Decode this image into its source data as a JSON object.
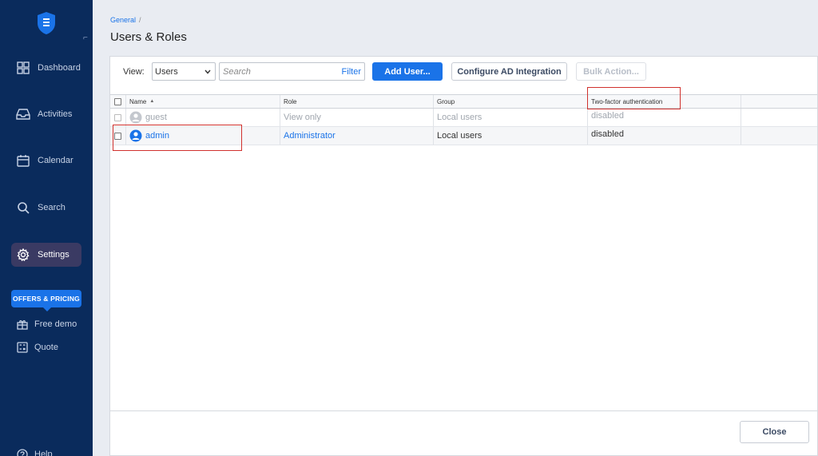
{
  "sidebar": {
    "items": [
      {
        "label": "Dashboard",
        "icon": "grid-icon"
      },
      {
        "label": "Activities",
        "icon": "inbox-icon"
      },
      {
        "label": "Calendar",
        "icon": "calendar-icon"
      },
      {
        "label": "Search",
        "icon": "search-icon"
      },
      {
        "label": "Settings",
        "icon": "gear-icon"
      }
    ],
    "offers_label": "OFFERS & PRICING",
    "free_demo_label": "Free demo",
    "quote_label": "Quote",
    "help_label": "Help"
  },
  "header": {
    "breadcrumb": "General",
    "breadcrumb_sep": "/",
    "title": "Users & Roles"
  },
  "toolbar": {
    "view_label": "View:",
    "view_value": "Users",
    "search_placeholder": "Search",
    "filter_label": "Filter",
    "add_user_label": "Add User...",
    "configure_ad_label": "Configure AD Integration",
    "bulk_action_label": "Bulk Action..."
  },
  "table": {
    "columns": [
      "Name",
      "Role",
      "Group",
      "Two-factor authentication"
    ],
    "rows": [
      {
        "name": "guest",
        "role": "View only",
        "group": "Local users",
        "tfa": "disabled"
      },
      {
        "name": "admin",
        "role": "Administrator",
        "group": "Local users",
        "tfa": "disabled"
      }
    ]
  },
  "footer": {
    "close_label": "Close"
  },
  "colors": {
    "sidebar_bg": "#0a2b5c",
    "accent": "#1a73e8",
    "highlight": "#d0312d"
  }
}
